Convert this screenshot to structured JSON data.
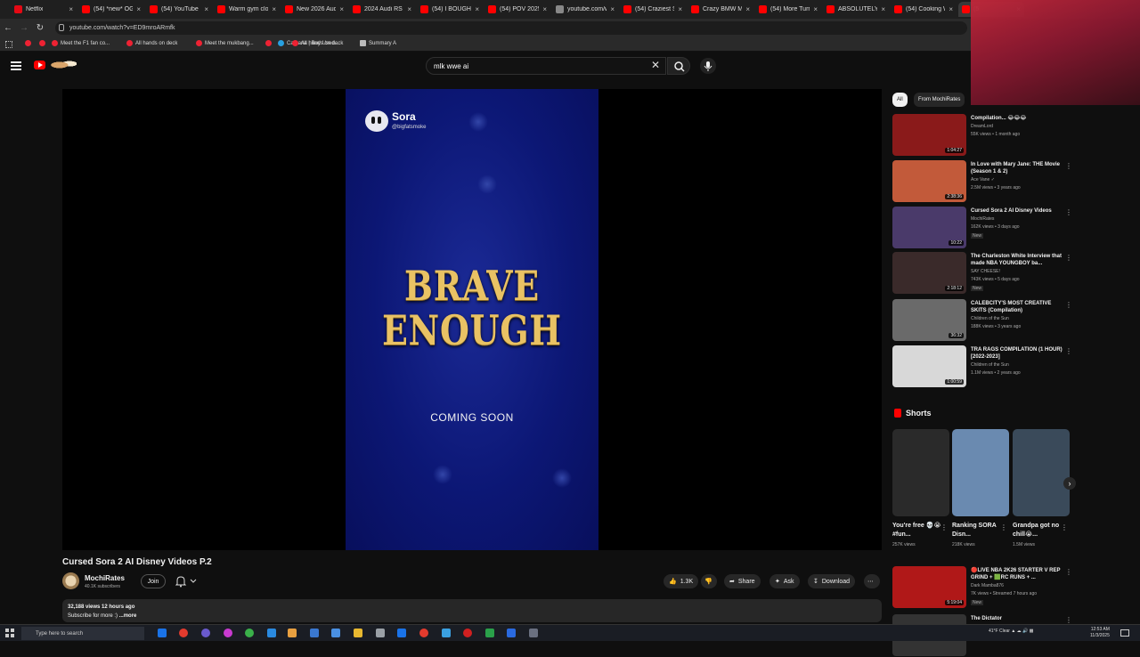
{
  "browser": {
    "tabs": [
      {
        "label": "Netflix",
        "color": "#e50914"
      },
      {
        "label": "(54) *new* OG",
        "color": "#ff0000"
      },
      {
        "label": "(54) YouTube",
        "color": "#ff0000"
      },
      {
        "label": "Warm gym clo",
        "color": "#ff0000"
      },
      {
        "label": "New 2026 Aud",
        "color": "#ff0000"
      },
      {
        "label": "2024 Audi RS",
        "color": "#ff0000"
      },
      {
        "label": "(54) I BOUGHT",
        "color": "#ff0000"
      },
      {
        "label": "(54) POV 2025",
        "color": "#ff0000"
      },
      {
        "label": "youtube.com/w",
        "color": "#888888"
      },
      {
        "label": "(54) Craziest S",
        "color": "#ff0000"
      },
      {
        "label": "Crazy BMW M",
        "color": "#ff0000"
      },
      {
        "label": "(54) More Turn",
        "color": "#ff0000"
      },
      {
        "label": "ABSOLUTELY S",
        "color": "#ff0000"
      },
      {
        "label": "(54) Cooking W",
        "color": "#ff0000"
      },
      {
        "label": "(5",
        "color": "#ff0000"
      }
    ],
    "url": "youtube.com/watch?v=ED9mroARmfk",
    "bookmarks": [
      {
        "label": ""
      },
      {
        "label": ""
      },
      {
        "label": "Meet the F1 fan co..."
      },
      {
        "label": "All hands on deck"
      },
      {
        "label": "Meet the mukbang..."
      },
      {
        "label": ""
      },
      {
        "label": "Carvana | Buy Used..."
      },
      {
        "label": "All hands on deck"
      },
      {
        "label": "Summary A"
      }
    ]
  },
  "header": {
    "search_query": "mlk wwe ai"
  },
  "player": {
    "sora_name": "Sora",
    "sora_handle": "@bigfatsmoke",
    "overlay_title": "BRAVE\nENOUGH",
    "overlay_subtitle": "COMING SOON"
  },
  "video": {
    "title": "Cursed Sora 2 AI Disney Videos P.2",
    "channel": "MochiRates",
    "subscribers": "40.1K subscribers",
    "join_label": "Join",
    "likes": "1.3K",
    "share_label": "Share",
    "ask_label": "Ask",
    "download_label": "Download",
    "views_line": "32,188 views  12 hours ago",
    "description": "Subscribe for more :)",
    "more_label": "...more"
  },
  "sidebar": {
    "chips": [
      "All",
      "From MochiRates"
    ],
    "recommendations": [
      {
        "title": "Compilation... 😂😂😂",
        "channel": "DreamLord",
        "meta": "55K views • 1 month ago",
        "duration": "1:04:27",
        "badge": "",
        "color": "#8a1a1a"
      },
      {
        "title": "In Love with Mary Jane: THE Movie (Season 1 & 2)",
        "channel": "Ace Vane ✓",
        "meta": "2.5M views • 3 years ago",
        "duration": "2:38:36",
        "badge": "",
        "color": "#c25a3a"
      },
      {
        "title": "Cursed Sora 2 AI Disney Videos",
        "channel": "MochiRates",
        "meta": "162K views • 3 days ago",
        "duration": "10:22",
        "badge": "New",
        "color": "#4a3a6a"
      },
      {
        "title": "The Charleston White Interview that made NBA YOUNGBOY ba...",
        "channel": "SAY CHEESE!",
        "meta": "743K views • 5 days ago",
        "duration": "2:18:12",
        "badge": "New",
        "color": "#3a2a2a"
      },
      {
        "title": "CALEBCITY'S MOST CREATIVE SKITS (Compilation)",
        "channel": "Children of the Sun",
        "meta": "188K views • 3 years ago",
        "duration": "36:32",
        "badge": "",
        "color": "#6a6a6a"
      },
      {
        "title": "TRA RAGS COMPILATION (1 HOUR) [2022-2023]",
        "channel": "Children of the Sun",
        "meta": "1.1M views • 2 years ago",
        "duration": "1:00:59",
        "badge": "",
        "color": "#d8d8d8"
      }
    ],
    "shorts_heading": "Shorts",
    "shorts": [
      {
        "title": "You're free 💀😭 #fun...",
        "views": "257K views",
        "color": "#2a2a2a"
      },
      {
        "title": "Ranking SORA Disn...",
        "views": "218K views",
        "color": "#6a8ab0"
      },
      {
        "title": "Grandpa got no chill😭...",
        "views": "1.5M views",
        "color": "#3a4a5a"
      }
    ],
    "bottom_recs": [
      {
        "title": "🔴LIVE NBA 2K26 STARTER V REP GRIND + 🟩RC RUNS + ...",
        "channel": "Dark Mamba876",
        "meta": "7K views • Streamed 7 hours ago",
        "duration": "5:19:04",
        "badge": "New",
        "color": "#b01818"
      },
      {
        "title": "The Dictator",
        "channel": "",
        "meta": "",
        "duration": "",
        "badge": "",
        "color": "#333333"
      }
    ]
  },
  "taskbar": {
    "search_placeholder": "Type here to search",
    "weather": "41°F Clear",
    "time": "12:53 AM",
    "date": "11/3/2025"
  }
}
